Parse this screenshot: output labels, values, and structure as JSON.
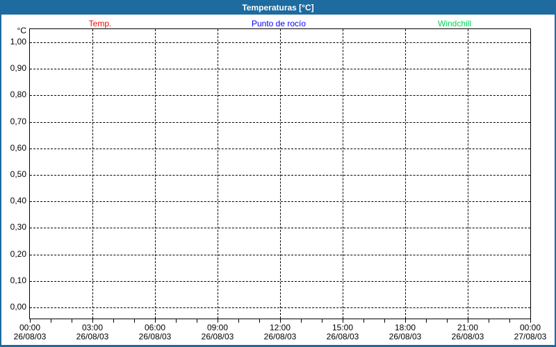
{
  "window": {
    "title": "Temperaturas [°C]"
  },
  "colors": {
    "titlebar_bg": "#1d6b9f",
    "frame_border": "#1d6b9f",
    "paper": "#ffffff",
    "grid": "#000000",
    "axis_text": "#000000",
    "temp": "#ff0000",
    "dew_point": "#0000ff",
    "windchill": "#00d455"
  },
  "legend": {
    "items": [
      {
        "label": "Temp.",
        "color": "#ff0000"
      },
      {
        "label": "Punto de rocío",
        "color": "#0000ff"
      },
      {
        "label": "Windchill",
        "color": "#00d455"
      }
    ]
  },
  "chart_data": {
    "type": "line",
    "title": "Temperaturas [°C]",
    "xlabel": "",
    "ylabel": "°C",
    "ylim": [
      0.0,
      1.0
    ],
    "grid": "dashed-both-axes",
    "legend_position": "top",
    "y_ticks": [
      {
        "label": "1,00",
        "value": 1.0
      },
      {
        "label": "0,90",
        "value": 0.9
      },
      {
        "label": "0,80",
        "value": 0.8
      },
      {
        "label": "0,70",
        "value": 0.7
      },
      {
        "label": "0,60",
        "value": 0.6
      },
      {
        "label": "0,50",
        "value": 0.5
      },
      {
        "label": "0,40",
        "value": 0.4
      },
      {
        "label": "0,30",
        "value": 0.3
      },
      {
        "label": "0,20",
        "value": 0.2
      },
      {
        "label": "0,10",
        "value": 0.1
      },
      {
        "label": "0,00",
        "value": 0.0
      }
    ],
    "x_axis": {
      "range_hours": [
        0,
        24
      ],
      "major_tick_interval_hours": 3,
      "minor_tick_interval_hours": 1,
      "major_ticks": [
        {
          "hour": 0,
          "time": "00:00",
          "date": "26/08/03"
        },
        {
          "hour": 3,
          "time": "03:00",
          "date": "26/08/03"
        },
        {
          "hour": 6,
          "time": "06:00",
          "date": "26/08/03"
        },
        {
          "hour": 9,
          "time": "09:00",
          "date": "26/08/03"
        },
        {
          "hour": 12,
          "time": "12:00",
          "date": "26/08/03"
        },
        {
          "hour": 15,
          "time": "15:00",
          "date": "26/08/03"
        },
        {
          "hour": 18,
          "time": "18:00",
          "date": "26/08/03"
        },
        {
          "hour": 21,
          "time": "21:00",
          "date": "26/08/03"
        },
        {
          "hour": 24,
          "time": "00:00",
          "date": "27/08/03"
        }
      ]
    },
    "series": [
      {
        "name": "Temp.",
        "color": "#ff0000",
        "points": []
      },
      {
        "name": "Punto de rocío",
        "color": "#0000ff",
        "points": []
      },
      {
        "name": "Windchill",
        "color": "#00d455",
        "points": []
      }
    ],
    "note_visible_data": "plot area is empty - no curves drawn"
  }
}
